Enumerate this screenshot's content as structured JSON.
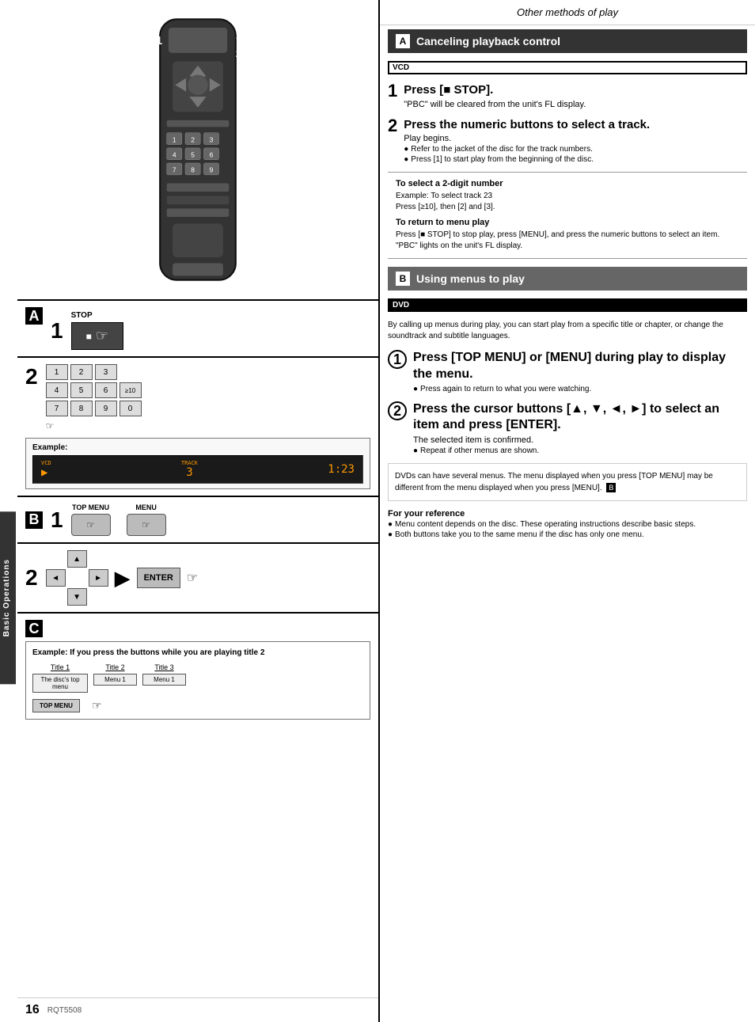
{
  "page": {
    "title": "Other methods of play",
    "page_number": "16",
    "part_number": "RQT5508"
  },
  "sidebar": {
    "label": "Basic Operations"
  },
  "left": {
    "section_a_label": "A",
    "step1_label": "1",
    "stop_label": "STOP",
    "section2_label": "2",
    "numpad": [
      "1",
      "2",
      "3",
      "4",
      "5",
      "6",
      "≥10",
      "7",
      "8",
      "9",
      "0"
    ],
    "example_label": "Example:",
    "display_vcd": "VCD",
    "display_track": "TRACK",
    "display_number": "3",
    "display_time": "1:23",
    "section_b_label": "B",
    "top_menu_label": "TOP MENU",
    "menu_label": "MENU",
    "enter_label": "ENTER",
    "section_c_label": "C",
    "example_title": "Example: If you press the buttons while you are playing title 2",
    "title1": "Title 1",
    "title2": "Title 2",
    "title3": "Title 3",
    "disc_top_menu": "The disc's top menu",
    "menu1": "Menu 1",
    "menu2": "Menu 1",
    "menu3": "Menu 1",
    "top_menu_btn": "TOP MENU"
  },
  "right": {
    "section_a": {
      "label": "A",
      "title": "Canceling playback control",
      "badge": "VCD",
      "step1_num": "1",
      "step1_title": "Press [■ STOP].",
      "step1_sub": "\"PBC\" will be cleared from the unit's FL display.",
      "step2_num": "2",
      "step2_title": "Press the numeric buttons to select a track.",
      "step2_sub": "Play begins.",
      "step2_bullet1": "Refer to the jacket of the disc for the track numbers.",
      "step2_bullet2": "Press [1] to start play from the beginning of the disc.",
      "hint1_title": "To select a 2-digit number",
      "hint1_text": "Example:  To select track 23\nPress [≥10], then [2] and [3].",
      "hint2_title": "To return to menu play",
      "hint2_text": "Press [■ STOP] to stop play, press [MENU], and press the numeric buttons to select an item.\n\"PBC\" lights on the unit's FL display."
    },
    "section_b": {
      "label": "B",
      "title": "Using menus to play",
      "badge": "DVD",
      "desc": "By calling up menus during play, you can start play from a specific title or chapter, or change the soundtrack and subtitle languages.",
      "step1_num": "1",
      "step1_title": "Press [TOP MENU] or [MENU] during play to display the menu.",
      "step1_bullet": "Press again to return to what you were watching.",
      "step2_num": "2",
      "step2_title": "Press the cursor buttons [▲, ▼, ◄, ►] to select an item and press [ENTER].",
      "step2_sub": "The selected item is confirmed.",
      "step2_bullet": "Repeat if other menus are shown.",
      "note_text": "DVDs can have several menus. The menu displayed when you press [TOP MENU] may be different from the menu displayed when you press [MENU].",
      "for_ref_title": "For your reference",
      "for_ref1": "Menu content depends on the disc. These operating instructions describe basic steps.",
      "for_ref2": "Both buttons take you to the same menu if the disc has only one menu."
    }
  }
}
